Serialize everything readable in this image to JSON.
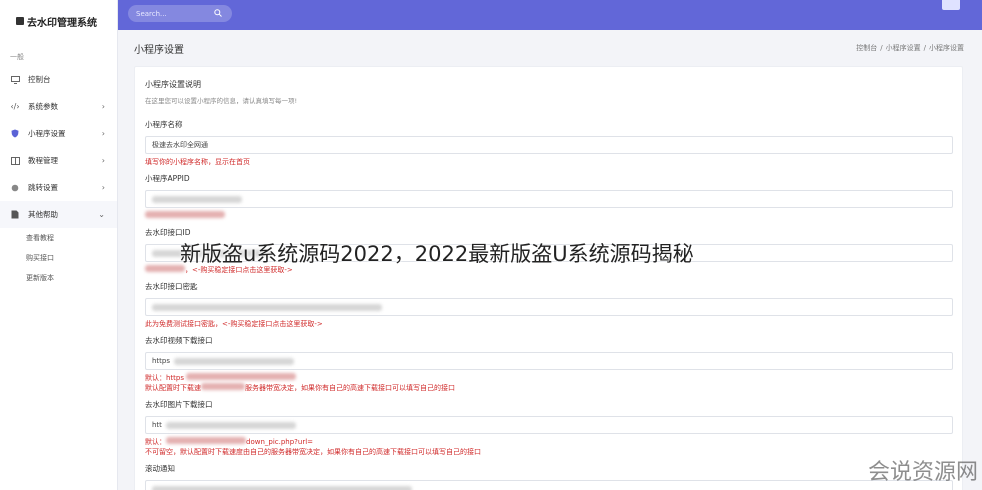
{
  "app": {
    "title": "去水印管理系统"
  },
  "sidebar": {
    "section": "一般",
    "items": [
      {
        "label": "控制台",
        "icon": "monitor-icon",
        "chevron": ""
      },
      {
        "label": "系统参数",
        "icon": "code-icon",
        "chevron": "›"
      },
      {
        "label": "小程序设置",
        "icon": "shield-icon",
        "chevron": "›"
      },
      {
        "label": "教程管理",
        "icon": "book-icon",
        "chevron": "›"
      },
      {
        "label": "跳转设置",
        "icon": "circle-icon",
        "chevron": "›"
      },
      {
        "label": "其他帮助",
        "icon": "document-icon",
        "chevron": "⌄"
      }
    ],
    "sub_items": [
      "查看教程",
      "购买接口",
      "更新版本"
    ]
  },
  "topbar": {
    "search_placeholder": "Search..."
  },
  "page": {
    "title": "小程序设置",
    "breadcrumb": [
      "控制台",
      "小程序设置",
      "小程序设置"
    ]
  },
  "card": {
    "title": "小程序设置说明",
    "desc": "在这里您可以设置小程序的信息，请认真填写每一项!",
    "fields": [
      {
        "label": "小程序名称",
        "value": "极速去水印全网通",
        "hint": "填写你的小程序名称，显示在首页"
      },
      {
        "label": "小程序APPID",
        "value": "",
        "hint": ""
      },
      {
        "label": "去水印接口ID",
        "value": "",
        "hint": "，<-购买稳定接口点击这里获取->"
      },
      {
        "label": "去水印接口密匙",
        "value": "",
        "hint": "此为免费测试接口密匙，<-购买稳定接口点击这里获取->"
      },
      {
        "label": "去水印视频下载接口",
        "value": "https",
        "hint_line1": "默认：https",
        "hint_line2": "默认配置时下载速",
        "hint_line2b": "服务器带宽决定，如果你有自己的高速下载接口可以填写自己的接口"
      },
      {
        "label": "去水印图片下载接口",
        "value": "htt",
        "hint_line1": "默认：",
        "hint_line1b": "down_pic.php?url=",
        "hint_line2": "不可留空，默认配置时下载速度由自己的服务器带宽决定，如果你有自己的高速下载接口可以填写自己的接口"
      },
      {
        "label": "滚动通知",
        "value": ""
      }
    ]
  },
  "overlay": {
    "text": "新版盗u系统源码2022，2022最新版盗U系统源码揭秘"
  },
  "watermark": {
    "text": "会说资源网"
  },
  "colors": {
    "accent": "#6267d8",
    "hint": "#d02a2a"
  }
}
